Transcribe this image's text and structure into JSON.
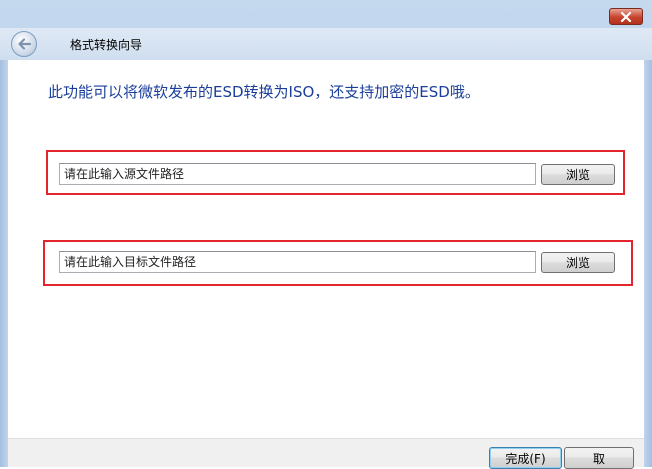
{
  "window": {
    "title": "格式转换向导",
    "close_icon": "close-icon",
    "back_icon": "back-arrow-icon"
  },
  "main": {
    "description": "此功能可以将微软发布的ESD转换为ISO，还支持加密的ESD哦。",
    "source": {
      "placeholder": "请在此输入源文件路径",
      "browse_label": "浏览"
    },
    "target": {
      "placeholder": "请在此输入目标文件路径",
      "browse_label": "浏览"
    }
  },
  "footer": {
    "finish_label": "完成(F)",
    "cancel_label": "取"
  },
  "colors": {
    "highlight_border": "#e3262e",
    "heading_text": "#1a3e9a",
    "frame": "#b9cfe9"
  }
}
